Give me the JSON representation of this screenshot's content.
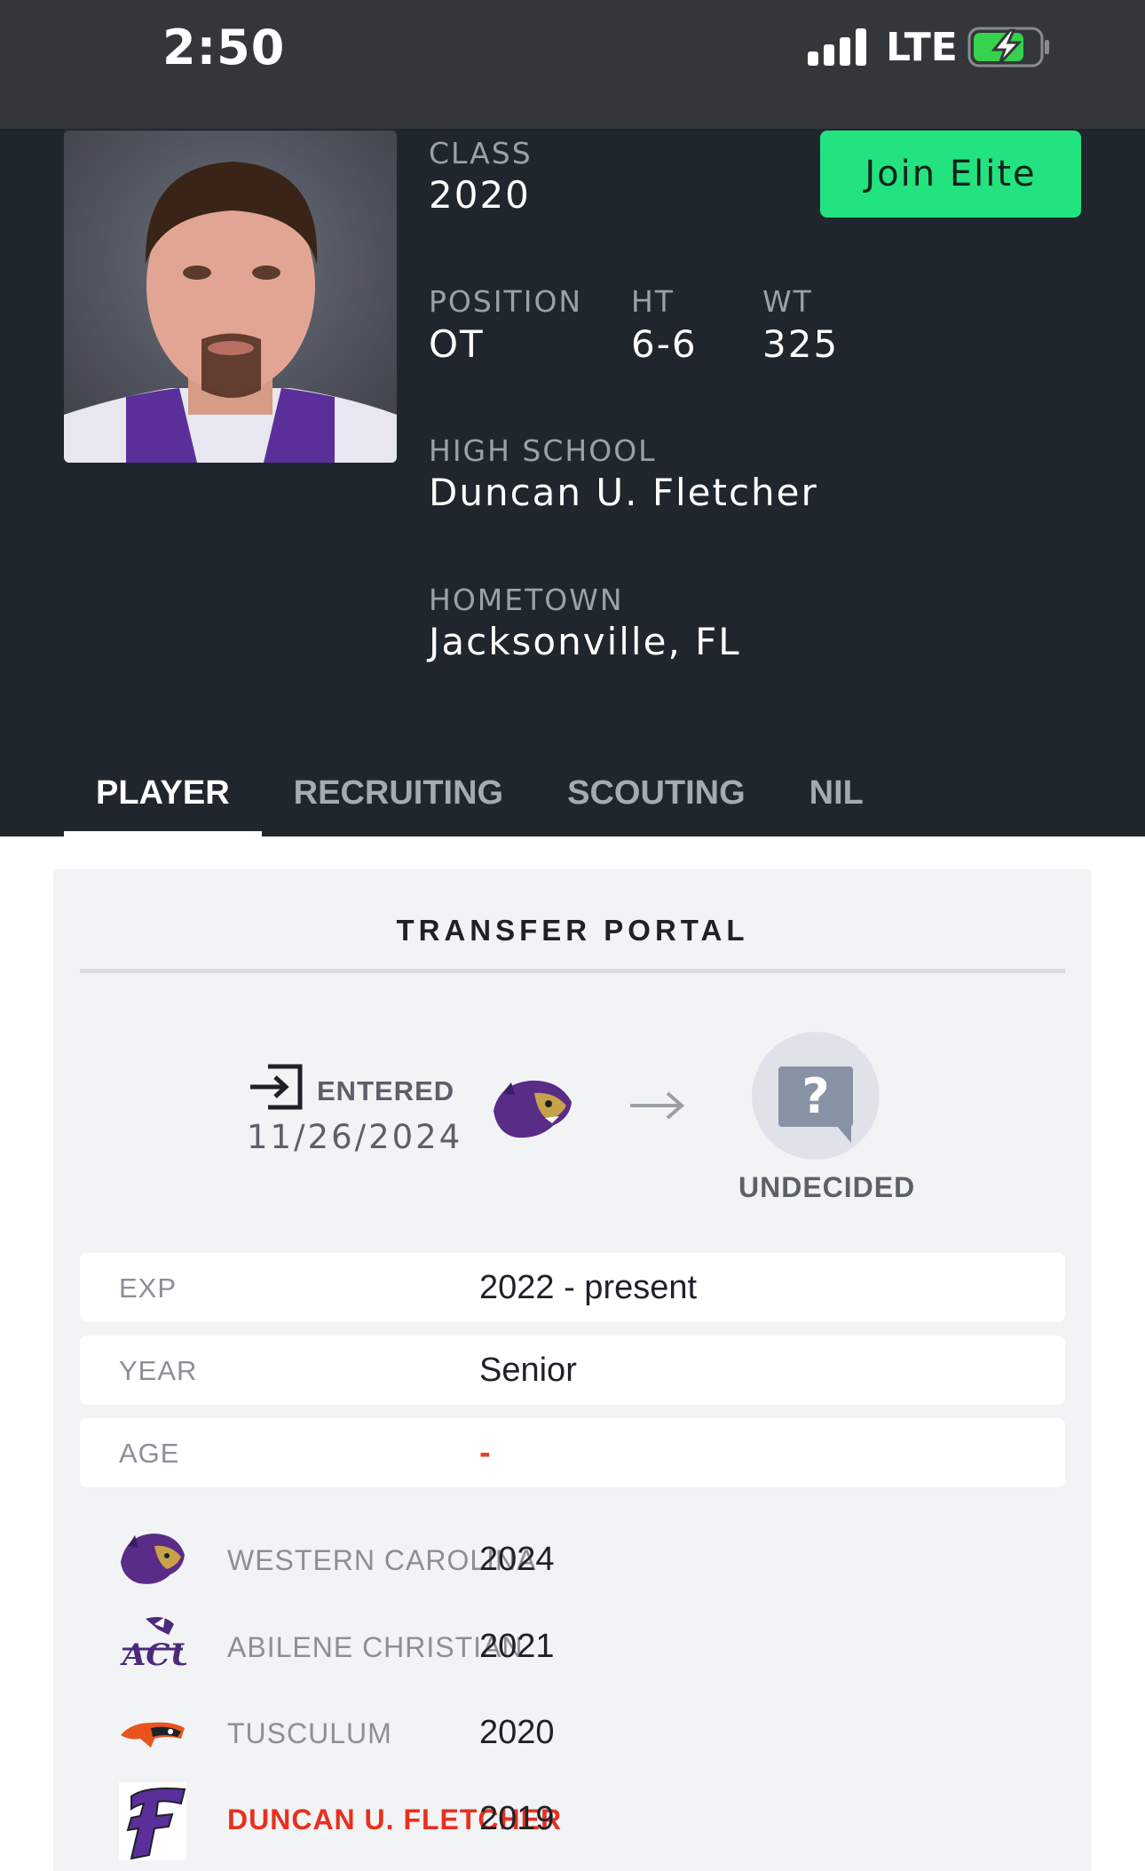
{
  "status_bar": {
    "time": "2:50",
    "network": "LTE"
  },
  "player": {
    "class_label": "CLASS",
    "class_value": "2020",
    "position_label": "POSITION",
    "position_value": "OT",
    "ht_label": "HT",
    "ht_value": "6-6",
    "wt_label": "WT",
    "wt_value": "325",
    "high_school_label": "HIGH SCHOOL",
    "high_school_value": "Duncan U. Fletcher",
    "hometown_label": "HOMETOWN",
    "hometown_value": "Jacksonville, FL"
  },
  "join_button": "Join Elite",
  "tabs": [
    {
      "label": "PLAYER",
      "active": true
    },
    {
      "label": "RECRUITING",
      "active": false
    },
    {
      "label": "SCOUTING",
      "active": false
    },
    {
      "label": "NIL",
      "active": false
    }
  ],
  "transfer_portal": {
    "title": "TRANSFER PORTAL",
    "entered_label": "ENTERED",
    "entered_date": "11/26/2024",
    "destination_label": "UNDECIDED",
    "destination_icon": "question-bubble-icon"
  },
  "details": [
    {
      "label": "EXP",
      "value": "2022 - present"
    },
    {
      "label": "YEAR",
      "value": "Senior"
    },
    {
      "label": "AGE",
      "value": "-"
    }
  ],
  "schools": [
    {
      "name": "WESTERN CAROLINA",
      "year": "2024",
      "logo": "western-carolina-logo"
    },
    {
      "name": "ABILENE CHRISTIAN",
      "year": "2021",
      "logo": "abilene-christian-logo"
    },
    {
      "name": "TUSCULUM",
      "year": "2020",
      "logo": "tusculum-logo"
    },
    {
      "name": "DUNCAN U. FLETCHER",
      "year": "2019",
      "logo": "fletcher-logo"
    }
  ],
  "colors": {
    "header_bg": "#20262d",
    "accent_green": "#23e381",
    "highlight_red": "#e8301e",
    "wcu_purple": "#592c88"
  }
}
